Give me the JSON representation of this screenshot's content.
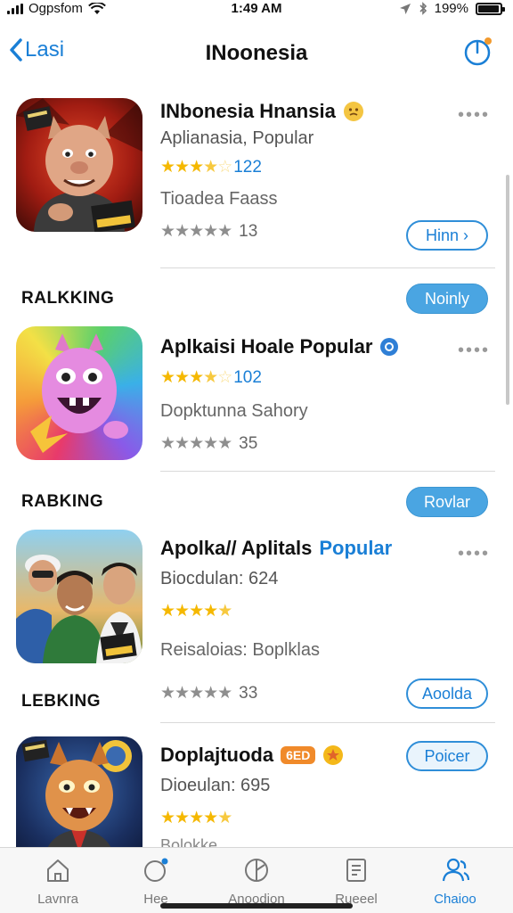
{
  "status_bar": {
    "carrier": "Ogpsfom",
    "time": "1:49 AM",
    "battery": "199%",
    "battery_level": 0.95
  },
  "nav": {
    "back_label": "Lasi",
    "title": "INoonesia",
    "right_icon": "timer-icon"
  },
  "apps": [
    {
      "title": "INbonesia Hnansia",
      "title_highlight": "",
      "subtitle": "Aplianasia, Popular",
      "rating_count": "122",
      "rating": 3.5,
      "desc": "Tioadea Faass",
      "grey_count": "13",
      "action": "Hinn ›",
      "more": "••••"
    },
    {
      "ranking": "RALKKING",
      "ranking_action": "Noinly",
      "title": "Aplkaisi Hoale Popular",
      "title_highlight": "",
      "rating_count": "102",
      "rating": 3.5,
      "desc": "Dopktunna Sahory",
      "grey_count": "35",
      "more": "••••"
    },
    {
      "ranking": "RABKING",
      "ranking_action": "Rovlar",
      "title": "Apolka// Aplitals",
      "title_highlight": "Popular",
      "subtitle": "Biocdulan: 624",
      "rating": 4.5,
      "desc": "Reisaloias: Boplklas",
      "grey_count": "33",
      "more": "••••"
    },
    {
      "ranking": "LEBKING",
      "ranking_action": "Aoolda",
      "title": "Doplajtuoda",
      "badge_label": "6ED",
      "subtitle": "Dioeulan: 695",
      "rating": 4.5,
      "action": "Poicer",
      "partial": "Bolokke"
    }
  ],
  "tabbar": {
    "tabs": [
      {
        "label": "Lavnra",
        "icon": "house-icon"
      },
      {
        "label": "Hee",
        "icon": "compass-icon"
      },
      {
        "label": "Anoodion",
        "icon": "globe-icon"
      },
      {
        "label": "Rueeel",
        "icon": "document-icon"
      },
      {
        "label": "Chaioo",
        "icon": "people-icon"
      }
    ],
    "active_index": 4
  },
  "colors": {
    "accent": "#1a7fd6",
    "button_fill": "#4aa5e2",
    "star": "#f5b800"
  }
}
